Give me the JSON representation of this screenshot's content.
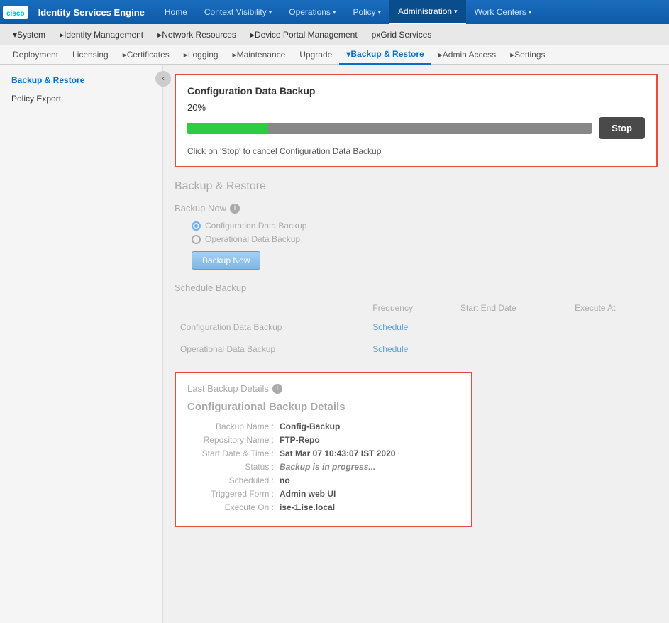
{
  "app": {
    "logo_text": "cisco",
    "title": "Identity Services Engine"
  },
  "top_nav": {
    "items": [
      {
        "label": "Home",
        "active": false,
        "has_arrow": false
      },
      {
        "label": "Context Visibility",
        "active": false,
        "has_arrow": true
      },
      {
        "label": "Operations",
        "active": false,
        "has_arrow": true
      },
      {
        "label": "Policy",
        "active": false,
        "has_arrow": true
      },
      {
        "label": "Administration",
        "active": true,
        "has_arrow": true
      },
      {
        "label": "Work Centers",
        "active": false,
        "has_arrow": true
      }
    ]
  },
  "second_nav": {
    "items": [
      {
        "label": "System",
        "has_arrow": true
      },
      {
        "label": "Identity Management",
        "has_arrow": true
      },
      {
        "label": "Network Resources",
        "has_arrow": true
      },
      {
        "label": "Device Portal Management",
        "has_arrow": true
      },
      {
        "label": "pxGrid Services",
        "has_arrow": false
      }
    ]
  },
  "third_nav": {
    "items": [
      {
        "label": "Deployment",
        "active": false
      },
      {
        "label": "Licensing",
        "active": false
      },
      {
        "label": "Certificates",
        "active": false,
        "has_arrow": true
      },
      {
        "label": "Logging",
        "active": false,
        "has_arrow": true
      },
      {
        "label": "Maintenance",
        "active": false,
        "has_arrow": true
      },
      {
        "label": "Upgrade",
        "active": false
      },
      {
        "label": "Backup & Restore",
        "active": true,
        "has_arrow": true
      },
      {
        "label": "Admin Access",
        "active": false,
        "has_arrow": true
      },
      {
        "label": "Settings",
        "active": false,
        "has_arrow": true
      }
    ]
  },
  "sidebar": {
    "items": [
      {
        "label": "Backup & Restore",
        "active": true
      },
      {
        "label": "Policy Export",
        "active": false
      }
    ]
  },
  "progress_box": {
    "title": "Configuration Data Backup",
    "percent": "20%",
    "percent_value": 20,
    "stop_label": "Stop",
    "hint": "Click on 'Stop' to cancel Configuration Data Backup"
  },
  "backup_restore": {
    "section_title": "Backup & Restore",
    "backup_now_label": "Backup Now",
    "backup_now_btn": "Backup Now",
    "radio_options": [
      {
        "label": "Configuration Data Backup",
        "selected": true
      },
      {
        "label": "Operational Data Backup",
        "selected": false
      }
    ],
    "schedule_backup_title": "Schedule Backup",
    "schedule_table": {
      "headers": [
        "",
        "Frequency",
        "Start End Date",
        "Execute At"
      ],
      "rows": [
        {
          "label": "Configuration Data Backup",
          "link": "Schedule",
          "frequency": "",
          "start_end": "",
          "execute_at": ""
        },
        {
          "label": "Operational Data Backup",
          "link": "Schedule",
          "frequency": "",
          "start_end": "",
          "execute_at": ""
        }
      ]
    }
  },
  "last_backup": {
    "header": "Last Backup Details",
    "subtitle": "Configurational Backup Details",
    "fields": [
      {
        "label": "Backup Name :",
        "value": "Config-Backup"
      },
      {
        "label": "Repository Name :",
        "value": "FTP-Repo"
      },
      {
        "label": "Start Date & Time :",
        "value": "Sat Mar 07 10:43:07 IST 2020"
      },
      {
        "label": "Status :",
        "value": "Backup is in progress..."
      },
      {
        "label": "Scheduled :",
        "value": "no"
      },
      {
        "label": "Triggered Form :",
        "value": "Admin web UI"
      },
      {
        "label": "Execute On :",
        "value": "ise-1.ise.local"
      }
    ]
  }
}
